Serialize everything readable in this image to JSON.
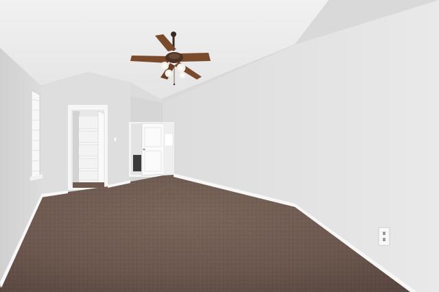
{
  "scene": {
    "subject": "empty bedroom",
    "features": [
      "vaulted-ceiling",
      "ceiling-fan-with-lights",
      "walk-in-closet",
      "open-doorway",
      "window",
      "carpet-floor",
      "baseboards",
      "electrical-outlet"
    ]
  },
  "colors": {
    "ceiling": "#ececec",
    "wall_light": "#e9e9e9",
    "wall_mid": "#dedede",
    "wall_shadow": "#d3d3d3",
    "carpet": "#6e5a50",
    "carpet_dark": "#5d4a41",
    "trim": "#f7f7f7",
    "fan_blade": "#7a4a2c",
    "fan_hub": "#4a3324"
  }
}
